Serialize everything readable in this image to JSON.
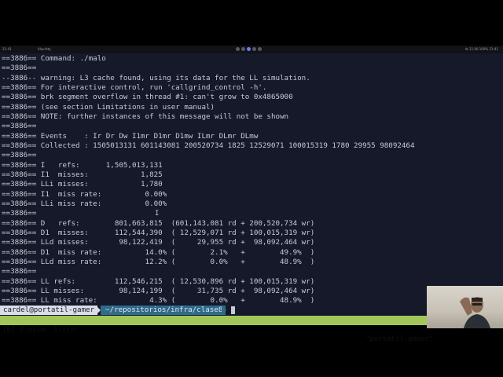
{
  "topbar": {
    "left_text": "21:41",
    "title": "Alacritty",
    "right_text": "rb 11.00 100%  21:41"
  },
  "terminal": {
    "lines": [
      "==3886== Command: ./malo",
      "==3886==",
      "--3886-- warning: L3 cache found, using its data for the LL simulation.",
      "==3886== For interactive control, run 'callgrind_control -h'.",
      "==3886== brk segment overflow in thread #1: can't grow to 0x4865000",
      "==3886== (see section Limitations in user manual)",
      "==3886== NOTE: further instances of this message will not be shown",
      "==3886==",
      "==3886== Events    : Ir Dr Dw I1mr D1mr D1mw ILmr DLmr DLmw",
      "==3886== Collected : 1505013131 601143081 200520734 1825 12529071 100015319 1780 29955 98092464",
      "==3886==",
      "==3886== I   refs:      1,505,013,131",
      "==3886== I1  misses:            1,825",
      "==3886== LLi misses:            1,780",
      "==3886== I1  miss rate:          0.00%",
      "==3886== LLi miss rate:          0.00%",
      "==3886==",
      "==3886== D   refs:        801,663,815  (601,143,081 rd + 200,520,734 wr)",
      "==3886== D1  misses:      112,544,390  ( 12,529,071 rd + 100,015,319 wr)",
      "==3886== LLd misses:       98,122,419  (     29,955 rd +  98,092,464 wr)",
      "==3886== D1  miss rate:          14.0% (        2.1%   +        49.9%  )",
      "==3886== LLd miss rate:          12.2% (        0.0%   +        48.9%  )",
      "==3886==",
      "==3886== LL refs:         112,546,215  ( 12,530,896 rd + 100,015,319 wr)",
      "==3886== LL misses:        98,124,199  (     31,735 rd +  98,092,464 wr)",
      "==3886== LL miss rate:            4.3% (        0.0%   +        48.9%  )"
    ],
    "cursor_glyph": "I"
  },
  "prompt": {
    "userhost": "cardel@portatil-gamer",
    "path": "~/repositorios/infra/clase8"
  },
  "tmux": {
    "left": "[0] 0:nvim- 1:zsh*",
    "right": "\"portatil-gamer\""
  },
  "colors": {
    "terminal_bg": "#15192a",
    "tmux_bar": "#a3c65a",
    "prompt_path_bg": "#2f6b8a",
    "prompt_user_bg": "#d9dde6"
  }
}
